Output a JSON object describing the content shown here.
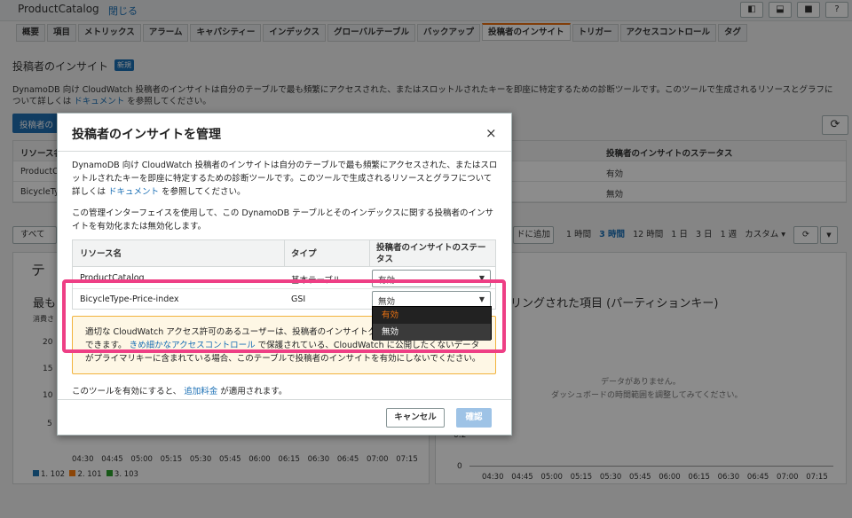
{
  "app": {
    "title": "ProductCatalog",
    "close": "閉じる"
  },
  "tabs": [
    "概要",
    "項目",
    "メトリックス",
    "アラーム",
    "キャパシティー",
    "インデックス",
    "グローバルテーブル",
    "バックアップ",
    "投稿者のインサイト",
    "トリガー",
    "アクセスコントロール",
    "タグ"
  ],
  "page": {
    "section_title": "投稿者のインサイト",
    "new_badge": "新規",
    "desc_pre": "DynamoDB 向け CloudWatch 投稿者のインサイトは自分のテーブルで最も頻繁にアクセスされた、またはスロットルされたキーを即座に特定するための診断ツールです。このツールで生成されるリソースとグラフについて詳しくは",
    "desc_link": "ドキュメント",
    "desc_post": "を参照してください。",
    "manage_btn": "投稿者の",
    "table_header_col1": "リソース名",
    "table_header_status": "投稿者のインサイトのステータス",
    "rows": [
      {
        "name": "ProductC",
        "status": "有効"
      },
      {
        "name": "BicycleTyp",
        "status": "無効"
      }
    ],
    "filter_all": "すべて",
    "add_dash": "ドに追加",
    "time_ranges": [
      "1 時間",
      "3 時間",
      "12 時間",
      "1 日",
      "3 日",
      "1 週",
      "カスタム ▾"
    ],
    "time_selected": "3 時間",
    "left_panel_title_top": "テ",
    "left_panel_title": "最も",
    "left_panel_ylabel": "消費さ",
    "left_y_ticks": [
      "20",
      "15",
      "10",
      "5"
    ],
    "x_ticks": [
      "04:30",
      "04:45",
      "05:00",
      "05:15",
      "05:30",
      "05:45",
      "06:00",
      "06:15",
      "06:30",
      "06:45",
      "07:00",
      "07:15"
    ],
    "legend": [
      {
        "label": "1. 102",
        "color": "#1f77b4"
      },
      {
        "label": "2. 101",
        "color": "#ff7f0e"
      },
      {
        "label": "3. 103",
        "color": "#2ca02c"
      }
    ],
    "right_panel_title": "リングされた項目 (パーティションキー)",
    "no_data": "データがありません。",
    "no_data_hint": "ダッシュボードの時間範囲を調整してみてください。",
    "right_y_ticks": [
      "0.2",
      "0"
    ]
  },
  "modal": {
    "title": "投稿者のインサイトを管理",
    "close": "×",
    "intro_pre": "DynamoDB 向け CloudWatch 投稿者のインサイトは自分のテーブルで最も頻繁にアクセスされた、またはスロットルされたキーを即座に特定するための診断ツールです。このツールで生成されるリソースとグラフについて詳しくは",
    "intro_link": "ドキュメント",
    "intro_post": "を参照してください。",
    "manage_desc": "この管理インターフェイスを使用して、この DynamoDB テーブルとそのインデックスに関する投稿者のインサイトを有効化または無効化します。",
    "col_resource": "リソース名",
    "col_type": "タイプ",
    "col_status": "投稿者のインサイトのステータス",
    "rows": [
      {
        "name": "ProductCatalog",
        "type": "基本テーブル",
        "status": "有効"
      },
      {
        "name": "BicycleType-Price-index",
        "type": "GSI",
        "status": "無効"
      }
    ],
    "dropdown_options": [
      "有効",
      "無効"
    ],
    "warn_pre": "適切な CloudWatch アクセス許可のあるユーザーは、投稿者のインサイトグ",
    "warn_line2_pre": "できます。",
    "warn_link": "きめ細かなアクセスコントロール",
    "warn_line2_post": "で保護されている、CloudWatch に公開したくないデータ",
    "warn_line3": "がプライマリキーに含まれている場合、このテーブルで投稿者のインサイトを有効にしないでください。",
    "footer_pre": "このツールを有効にすると、",
    "footer_link": "追加料金",
    "footer_post": "が適用されます。",
    "cancel": "キャンセル",
    "confirm": "確認"
  },
  "colors": {
    "accent": "#ec7211",
    "link": "#1a6fb5",
    "highlight": "#ee3f85"
  }
}
